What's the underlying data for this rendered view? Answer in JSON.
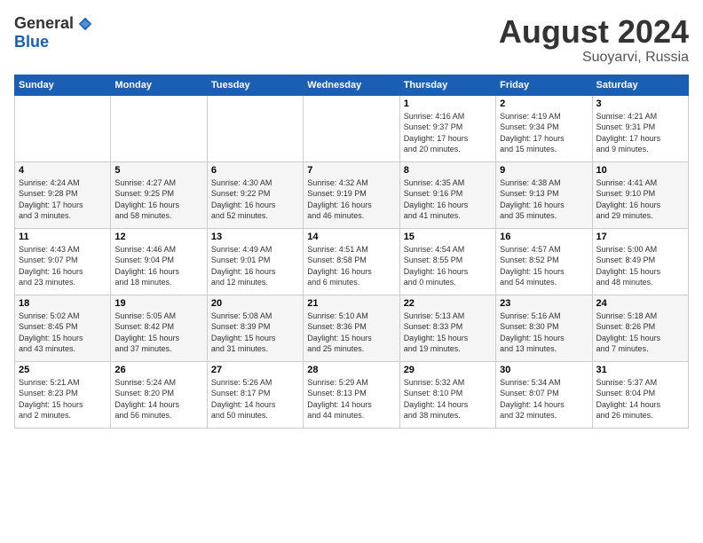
{
  "logo": {
    "general": "General",
    "blue": "Blue"
  },
  "title": "August 2024",
  "subtitle": "Suoyarvi, Russia",
  "days_header": [
    "Sunday",
    "Monday",
    "Tuesday",
    "Wednesday",
    "Thursday",
    "Friday",
    "Saturday"
  ],
  "weeks": [
    {
      "days": [
        {
          "num": "",
          "info": ""
        },
        {
          "num": "",
          "info": ""
        },
        {
          "num": "",
          "info": ""
        },
        {
          "num": "",
          "info": ""
        },
        {
          "num": "1",
          "info": "Sunrise: 4:16 AM\nSunset: 9:37 PM\nDaylight: 17 hours\nand 20 minutes."
        },
        {
          "num": "2",
          "info": "Sunrise: 4:19 AM\nSunset: 9:34 PM\nDaylight: 17 hours\nand 15 minutes."
        },
        {
          "num": "3",
          "info": "Sunrise: 4:21 AM\nSunset: 9:31 PM\nDaylight: 17 hours\nand 9 minutes."
        }
      ]
    },
    {
      "days": [
        {
          "num": "4",
          "info": "Sunrise: 4:24 AM\nSunset: 9:28 PM\nDaylight: 17 hours\nand 3 minutes."
        },
        {
          "num": "5",
          "info": "Sunrise: 4:27 AM\nSunset: 9:25 PM\nDaylight: 16 hours\nand 58 minutes."
        },
        {
          "num": "6",
          "info": "Sunrise: 4:30 AM\nSunset: 9:22 PM\nDaylight: 16 hours\nand 52 minutes."
        },
        {
          "num": "7",
          "info": "Sunrise: 4:32 AM\nSunset: 9:19 PM\nDaylight: 16 hours\nand 46 minutes."
        },
        {
          "num": "8",
          "info": "Sunrise: 4:35 AM\nSunset: 9:16 PM\nDaylight: 16 hours\nand 41 minutes."
        },
        {
          "num": "9",
          "info": "Sunrise: 4:38 AM\nSunset: 9:13 PM\nDaylight: 16 hours\nand 35 minutes."
        },
        {
          "num": "10",
          "info": "Sunrise: 4:41 AM\nSunset: 9:10 PM\nDaylight: 16 hours\nand 29 minutes."
        }
      ]
    },
    {
      "days": [
        {
          "num": "11",
          "info": "Sunrise: 4:43 AM\nSunset: 9:07 PM\nDaylight: 16 hours\nand 23 minutes."
        },
        {
          "num": "12",
          "info": "Sunrise: 4:46 AM\nSunset: 9:04 PM\nDaylight: 16 hours\nand 18 minutes."
        },
        {
          "num": "13",
          "info": "Sunrise: 4:49 AM\nSunset: 9:01 PM\nDaylight: 16 hours\nand 12 minutes."
        },
        {
          "num": "14",
          "info": "Sunrise: 4:51 AM\nSunset: 8:58 PM\nDaylight: 16 hours\nand 6 minutes."
        },
        {
          "num": "15",
          "info": "Sunrise: 4:54 AM\nSunset: 8:55 PM\nDaylight: 16 hours\nand 0 minutes."
        },
        {
          "num": "16",
          "info": "Sunrise: 4:57 AM\nSunset: 8:52 PM\nDaylight: 15 hours\nand 54 minutes."
        },
        {
          "num": "17",
          "info": "Sunrise: 5:00 AM\nSunset: 8:49 PM\nDaylight: 15 hours\nand 48 minutes."
        }
      ]
    },
    {
      "days": [
        {
          "num": "18",
          "info": "Sunrise: 5:02 AM\nSunset: 8:45 PM\nDaylight: 15 hours\nand 43 minutes."
        },
        {
          "num": "19",
          "info": "Sunrise: 5:05 AM\nSunset: 8:42 PM\nDaylight: 15 hours\nand 37 minutes."
        },
        {
          "num": "20",
          "info": "Sunrise: 5:08 AM\nSunset: 8:39 PM\nDaylight: 15 hours\nand 31 minutes."
        },
        {
          "num": "21",
          "info": "Sunrise: 5:10 AM\nSunset: 8:36 PM\nDaylight: 15 hours\nand 25 minutes."
        },
        {
          "num": "22",
          "info": "Sunrise: 5:13 AM\nSunset: 8:33 PM\nDaylight: 15 hours\nand 19 minutes."
        },
        {
          "num": "23",
          "info": "Sunrise: 5:16 AM\nSunset: 8:30 PM\nDaylight: 15 hours\nand 13 minutes."
        },
        {
          "num": "24",
          "info": "Sunrise: 5:18 AM\nSunset: 8:26 PM\nDaylight: 15 hours\nand 7 minutes."
        }
      ]
    },
    {
      "days": [
        {
          "num": "25",
          "info": "Sunrise: 5:21 AM\nSunset: 8:23 PM\nDaylight: 15 hours\nand 2 minutes."
        },
        {
          "num": "26",
          "info": "Sunrise: 5:24 AM\nSunset: 8:20 PM\nDaylight: 14 hours\nand 56 minutes."
        },
        {
          "num": "27",
          "info": "Sunrise: 5:26 AM\nSunset: 8:17 PM\nDaylight: 14 hours\nand 50 minutes."
        },
        {
          "num": "28",
          "info": "Sunrise: 5:29 AM\nSunset: 8:13 PM\nDaylight: 14 hours\nand 44 minutes."
        },
        {
          "num": "29",
          "info": "Sunrise: 5:32 AM\nSunset: 8:10 PM\nDaylight: 14 hours\nand 38 minutes."
        },
        {
          "num": "30",
          "info": "Sunrise: 5:34 AM\nSunset: 8:07 PM\nDaylight: 14 hours\nand 32 minutes."
        },
        {
          "num": "31",
          "info": "Sunrise: 5:37 AM\nSunset: 8:04 PM\nDaylight: 14 hours\nand 26 minutes."
        }
      ]
    }
  ]
}
